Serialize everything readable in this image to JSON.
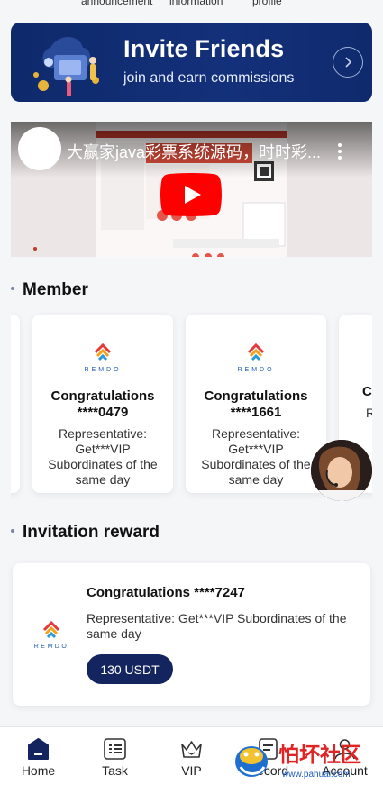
{
  "top_tabs": [
    "announcement",
    "information",
    "profile"
  ],
  "invite_banner": {
    "title": "Invite Friends",
    "subtitle": "join and earn commissions",
    "arrow_icon": "chevron-right-icon"
  },
  "video": {
    "title": "大赢家java彩票系统源码，时时彩...",
    "play_icon": "youtube-play-icon",
    "more_icon": "more-vertical-icon"
  },
  "member_section": {
    "title": "Member",
    "cards": [
      {
        "logo_text": "REMDO",
        "congrats": "Congratulations ****0479",
        "desc": "Representative: Get***VIP Subordinates of the same day"
      },
      {
        "logo_text": "REMDO",
        "congrats": "Congratulations ****1661",
        "desc": "Representative: Get***VIP Subordinates of the same day"
      },
      {
        "logo_text": "REMDO",
        "congrats": "C",
        "desc": "R"
      }
    ]
  },
  "reward_section": {
    "title": "Invitation reward",
    "card": {
      "logo_text": "REMDO",
      "congrats": "Congratulations ****7247",
      "desc": "Representative: Get***VIP Subordinates of the same day",
      "amount": "130 USDT"
    }
  },
  "tabbar": {
    "items": [
      {
        "label": "Home",
        "icon": "home-icon",
        "active": true
      },
      {
        "label": "Task",
        "icon": "task-list-icon",
        "active": false
      },
      {
        "label": "VIP",
        "icon": "crown-icon",
        "active": false
      },
      {
        "label": "Record",
        "icon": "record-icon",
        "active": false
      },
      {
        "label": "Account",
        "icon": "account-icon",
        "active": false
      }
    ]
  },
  "watermark": {
    "title": "怕坏社区",
    "url": "www.pahuai.com"
  },
  "colors": {
    "navy": "#14245f",
    "banner": "#13307a",
    "background": "#f5f6f8"
  }
}
